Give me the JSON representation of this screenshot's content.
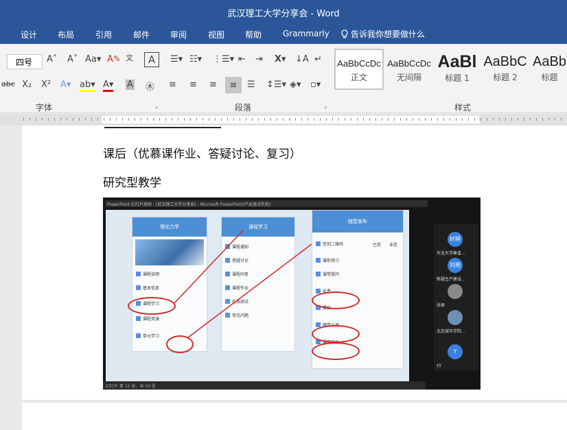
{
  "window": {
    "title": "武汉理工大学分享会  -  Word"
  },
  "menu": {
    "items": [
      "设计",
      "布局",
      "引用",
      "邮件",
      "审阅",
      "视图",
      "帮助",
      "Grammarly"
    ],
    "tell_me": "告诉我你想要做什么"
  },
  "ribbon": {
    "font_size": "四号",
    "font_group": "字体",
    "paragraph_group": "段落",
    "styles_group": "样式",
    "styles": [
      {
        "preview": "AaBbCcDc",
        "name": "正文"
      },
      {
        "preview": "AaBbCcDc",
        "name": "无间隔"
      },
      {
        "preview": "AaBl",
        "name": "标题 1"
      },
      {
        "preview": "AaBbC",
        "name": "标题 2"
      },
      {
        "preview": "AaBb",
        "name": "标题"
      }
    ]
  },
  "document": {
    "line1": "课后（优慕课作业、答疑讨论、复习）",
    "line2": "研究型教学"
  },
  "embedded": {
    "app_title": "PowerPoint 幻灯片放映 - [武汉理工大学分享会] - Microsoft PowerPoint(产品激活失败)",
    "phone1": {
      "title": "理论力学",
      "items": [
        "课程说明",
        "基本信息",
        "课程学习",
        "课程资源",
        "单元学习"
      ]
    },
    "phone2": {
      "title": "课程学习",
      "items": [
        "课程通知",
        "答疑讨论",
        "课程问卷",
        "课程作业",
        "在线测试",
        "常见问题"
      ]
    },
    "phone3": {
      "title": "随堂发布",
      "items": [
        "签到二维码",
        "课前预习",
        "课堂提问",
        "投票",
        "赞析",
        "随堂小测",
        "课堂评价"
      ],
      "status_done": "已签",
      "status_not": "未签"
    },
    "participants": [
      {
        "avatar": "好婷",
        "name": "东北大学秦皇..."
      },
      {
        "avatar": "刘燕",
        "name": "新疆生产建设..."
      },
      {
        "avatar": "",
        "name": "张君"
      },
      {
        "avatar": "",
        "name": "北京城市学院..."
      },
      {
        "avatar": "Y",
        "name": "yy"
      }
    ],
    "status_text": "幻灯片 第 15 张，共 50 张"
  },
  "colors": {
    "accent": "#2b579a",
    "annotation": "#d12a2a",
    "phone_header": "#4c8fd6"
  }
}
